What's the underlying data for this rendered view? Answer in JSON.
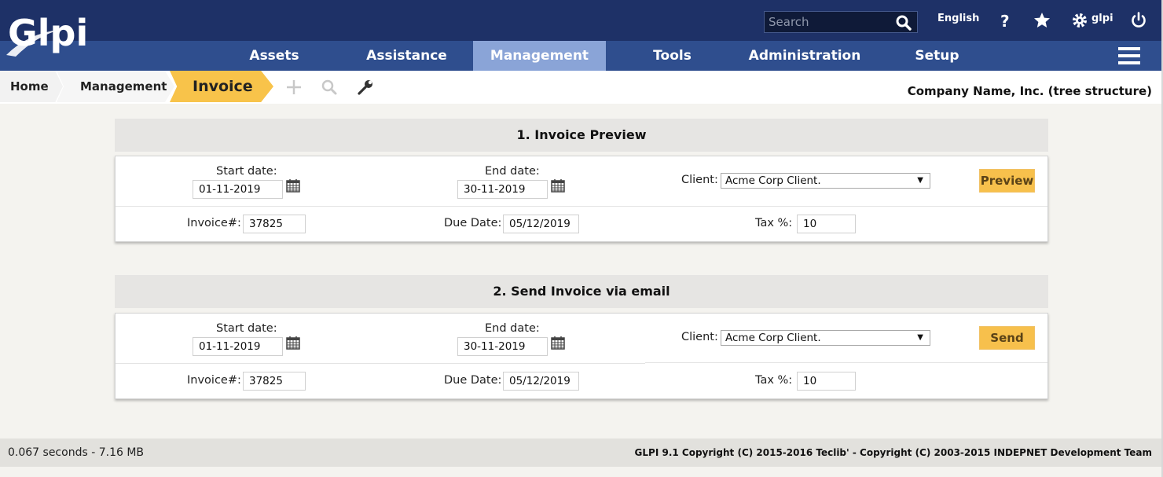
{
  "header": {
    "logo_text": "Glpi",
    "search_placeholder": "Search",
    "language": "English",
    "user": "glpi",
    "icons": [
      "help-icon",
      "star-icon",
      "gear-icon",
      "power-icon",
      "search-icon",
      "menu-icon"
    ]
  },
  "nav": {
    "items": [
      {
        "label": "Assets",
        "active": false
      },
      {
        "label": "Assistance",
        "active": false
      },
      {
        "label": "Management",
        "active": true
      },
      {
        "label": "Tools",
        "active": false
      },
      {
        "label": "Administration",
        "active": false
      },
      {
        "label": "Setup",
        "active": false
      }
    ]
  },
  "breadcrumb": {
    "home": "Home",
    "management": "Management",
    "current": "Invoice",
    "tools": [
      "add-icon",
      "search-icon",
      "wrench-icon"
    ]
  },
  "entity": "Company Name, Inc. (tree structure)",
  "sections": [
    {
      "title": "1. Invoice Preview",
      "start_label": "Start date:",
      "start_value": "01-11-2019",
      "end_label": "End date:",
      "end_value": "30-11-2019",
      "client_label": "Client:",
      "client_value": "Acme Corp Client.",
      "button": "Preview",
      "invoice_label": "Invoice#:",
      "invoice_value": "37825",
      "due_label": "Due Date:",
      "due_value": "05/12/2019",
      "tax_label": "Tax %:",
      "tax_value": "10"
    },
    {
      "title": "2. Send Invoice via email",
      "start_label": "Start date:",
      "start_value": "01-11-2019",
      "end_label": "End date:",
      "end_value": "30-11-2019",
      "client_label": "Client:",
      "client_value": "Acme Corp Client.",
      "button": "Send",
      "invoice_label": "Invoice#:",
      "invoice_value": "37825",
      "due_label": "Due Date:",
      "due_value": "05/12/2019",
      "tax_label": "Tax %:",
      "tax_value": "10"
    }
  ],
  "footer": {
    "stats": "0.067 seconds - 7.16 MB",
    "copyright": "GLPI 9.1 Copyright (C) 2015-2016 Teclib' - Copyright (C) 2003-2015 INDEPNET Development Team"
  },
  "colors": {
    "header_bg": "#1e3167",
    "nav_bg": "#2f4e8e",
    "nav_active": "#8aa4d7",
    "accent": "#f8c34a"
  }
}
